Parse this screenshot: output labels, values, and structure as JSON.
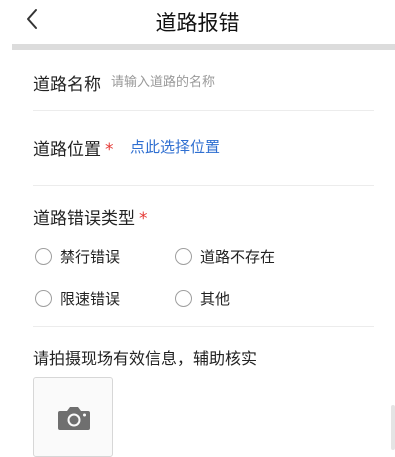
{
  "header": {
    "title": "道路报错",
    "back_icon": "chevron-left-icon"
  },
  "form": {
    "road_name": {
      "label": "道路名称",
      "placeholder": "请输入道路的名称"
    },
    "road_location": {
      "label": "道路位置",
      "required_mark": "*",
      "link_text": "点此选择位置"
    },
    "error_type": {
      "label": "道路错误类型",
      "required_mark": "*",
      "options": [
        "禁行错误",
        "道路不存在",
        "限速错误",
        "其他"
      ]
    },
    "photo": {
      "label": "请拍摄现场有效信息，辅助核实",
      "icon": "camera-icon"
    }
  },
  "colors": {
    "accent_link": "#2f6fd1",
    "required": "#e53935"
  }
}
